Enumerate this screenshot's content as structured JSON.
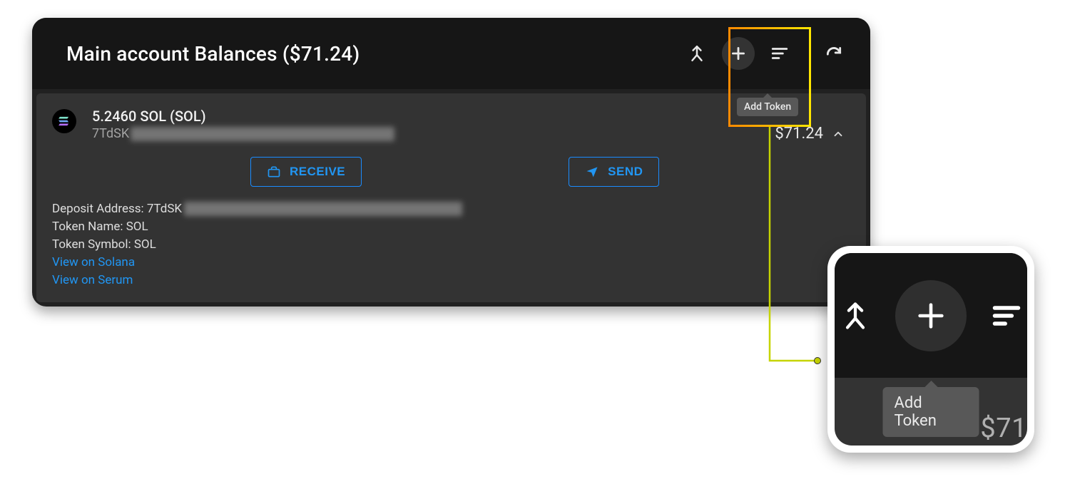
{
  "header": {
    "title": "Main account Balances ($71.24)",
    "buttons": {
      "merge": "merge-icon",
      "add": "plus-icon",
      "sort": "sort-icon",
      "refresh": "refresh-icon"
    }
  },
  "tooltip": {
    "add_token": "Add Token"
  },
  "row": {
    "icon": "solana-icon",
    "balance_line": "5.2460 SOL (SOL)",
    "address_prefix": "7TdSK",
    "usd_value": "$71.24"
  },
  "actions": {
    "receive": "RECEIVE",
    "send": "SEND"
  },
  "details": {
    "deposit_label": "Deposit Address: 7TdSK",
    "token_name": "Token Name: SOL",
    "token_symbol": "Token Symbol: SOL",
    "view_solana": "View on Solana",
    "view_serum": "View on Serum"
  },
  "zoom": {
    "tooltip": "Add Token",
    "usd_partial": "$71"
  }
}
